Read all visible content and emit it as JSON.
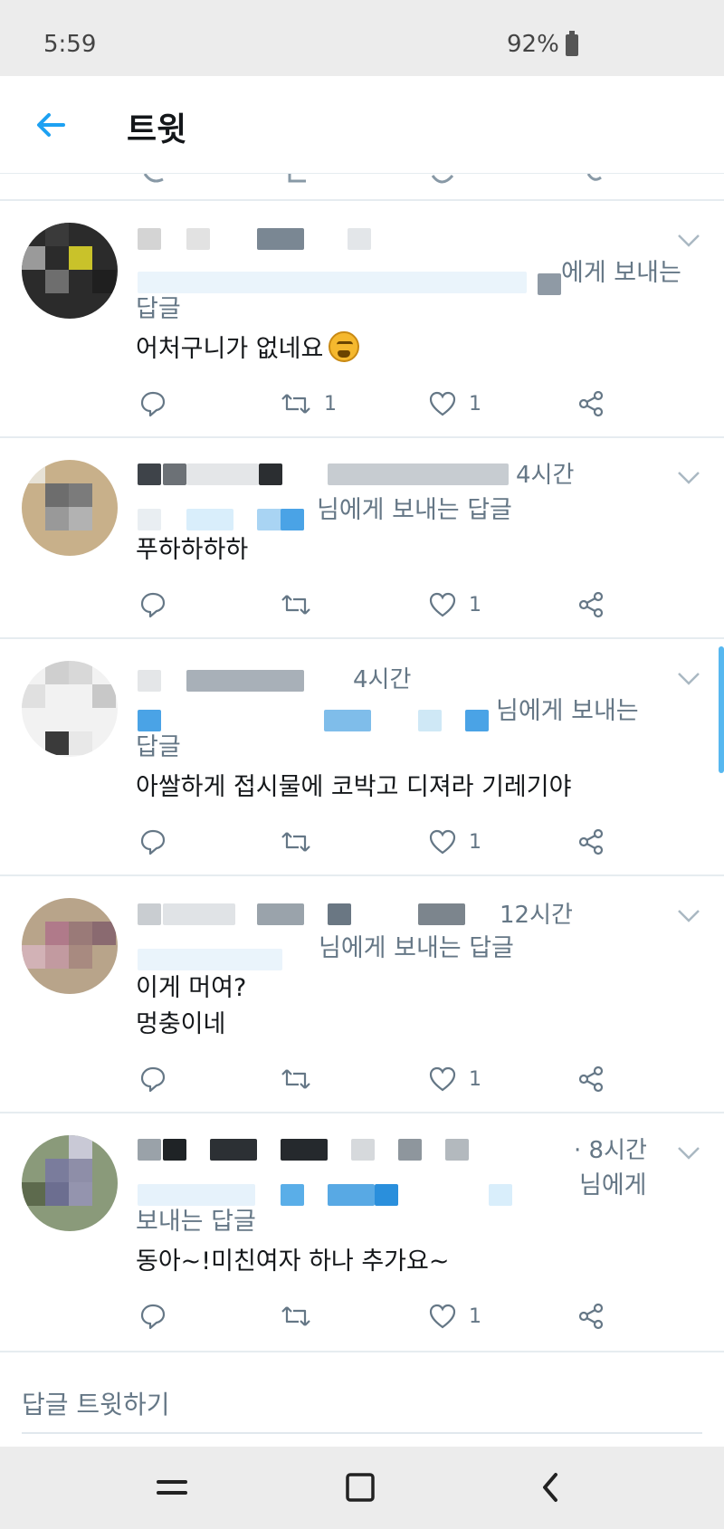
{
  "status_bar": {
    "time": "5:59",
    "battery": "92%",
    "battery_icon": "battery-icon"
  },
  "app_bar": {
    "back_icon": "arrow-left-icon",
    "title": "트윗",
    "accent_color": "#1da1f2"
  },
  "tweets": [
    {
      "timestamp": "",
      "reply_suffix": "에게 보내는",
      "reply_suffix_2": "답글",
      "text": "어처구니가 없네요",
      "emoji": "weary-face-emoji",
      "retweets": "1",
      "likes": "1"
    },
    {
      "timestamp": "4시간",
      "reply_suffix": "님에게 보내는 답글",
      "text": "푸하하하하",
      "retweets": "",
      "likes": "1"
    },
    {
      "timestamp": "4시간",
      "reply_suffix": "님에게 보내는",
      "reply_suffix_2": "답글",
      "text": "아쌀하게 접시물에 코박고 디져라 기레기야",
      "retweets": "",
      "likes": "1"
    },
    {
      "timestamp": "12시간",
      "reply_suffix": "님에게 보내는 답글",
      "text_line1": "이게 머여?",
      "text_line2": "멍충이네",
      "retweets": "",
      "likes": "1"
    },
    {
      "timestamp": "· 8시간",
      "reply_suffix": "님에게",
      "reply_suffix_2": "보내는 답글",
      "text": "동아~!미친여자 하나 추가요~",
      "retweets": "",
      "likes": "1"
    }
  ],
  "reply_box": {
    "placeholder": "답글 트윗하기"
  },
  "nav_bar": {
    "recent_icon": "recent-apps-icon",
    "home_icon": "home-square-icon",
    "back_icon": "back-chevron-icon"
  }
}
